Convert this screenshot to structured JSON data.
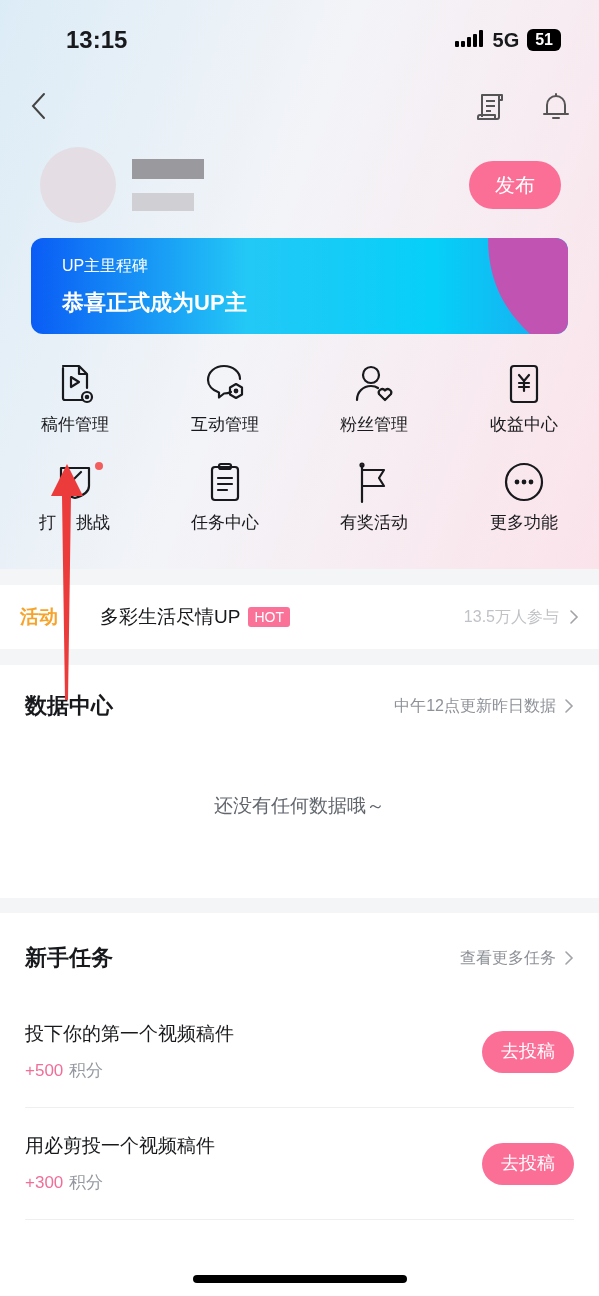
{
  "status_bar": {
    "time": "13:15",
    "network": "5G",
    "battery": "51"
  },
  "profile": {
    "publish_button": "发布"
  },
  "banner": {
    "subtitle": "UP主里程碑",
    "title": "恭喜正式成为UP主"
  },
  "tools": [
    {
      "kind": "video-file",
      "label": "稿件管理",
      "badge": false
    },
    {
      "kind": "chat",
      "label": "互动管理",
      "badge": false
    },
    {
      "kind": "fan",
      "label": "粉丝管理",
      "badge": false
    },
    {
      "kind": "yen",
      "label": "收益中心",
      "badge": false
    },
    {
      "kind": "shield",
      "label": "打",
      "label_after": "挑战",
      "badge": true
    },
    {
      "kind": "clipboard",
      "label": "任务中心",
      "badge": false
    },
    {
      "kind": "flag",
      "label": "有奖活动",
      "badge": false
    },
    {
      "kind": "more",
      "label": "更多功能",
      "badge": false
    }
  ],
  "activity": {
    "tag": "活动",
    "title": "多彩生活尽情UP",
    "badge": "HOT",
    "participants": "13.5万人参与"
  },
  "data_center": {
    "title": "数据中心",
    "link": "中午12点更新昨日数据",
    "empty": "还没有任何数据哦～"
  },
  "tasks": {
    "title": "新手任务",
    "link": "查看更多任务",
    "items": [
      {
        "title": "投下你的第一个视频稿件",
        "points": "+500",
        "unit": "积分",
        "button": "去投稿"
      },
      {
        "title": "用必剪投一个视频稿件",
        "points": "+300",
        "unit": "积分",
        "button": "去投稿"
      }
    ]
  }
}
